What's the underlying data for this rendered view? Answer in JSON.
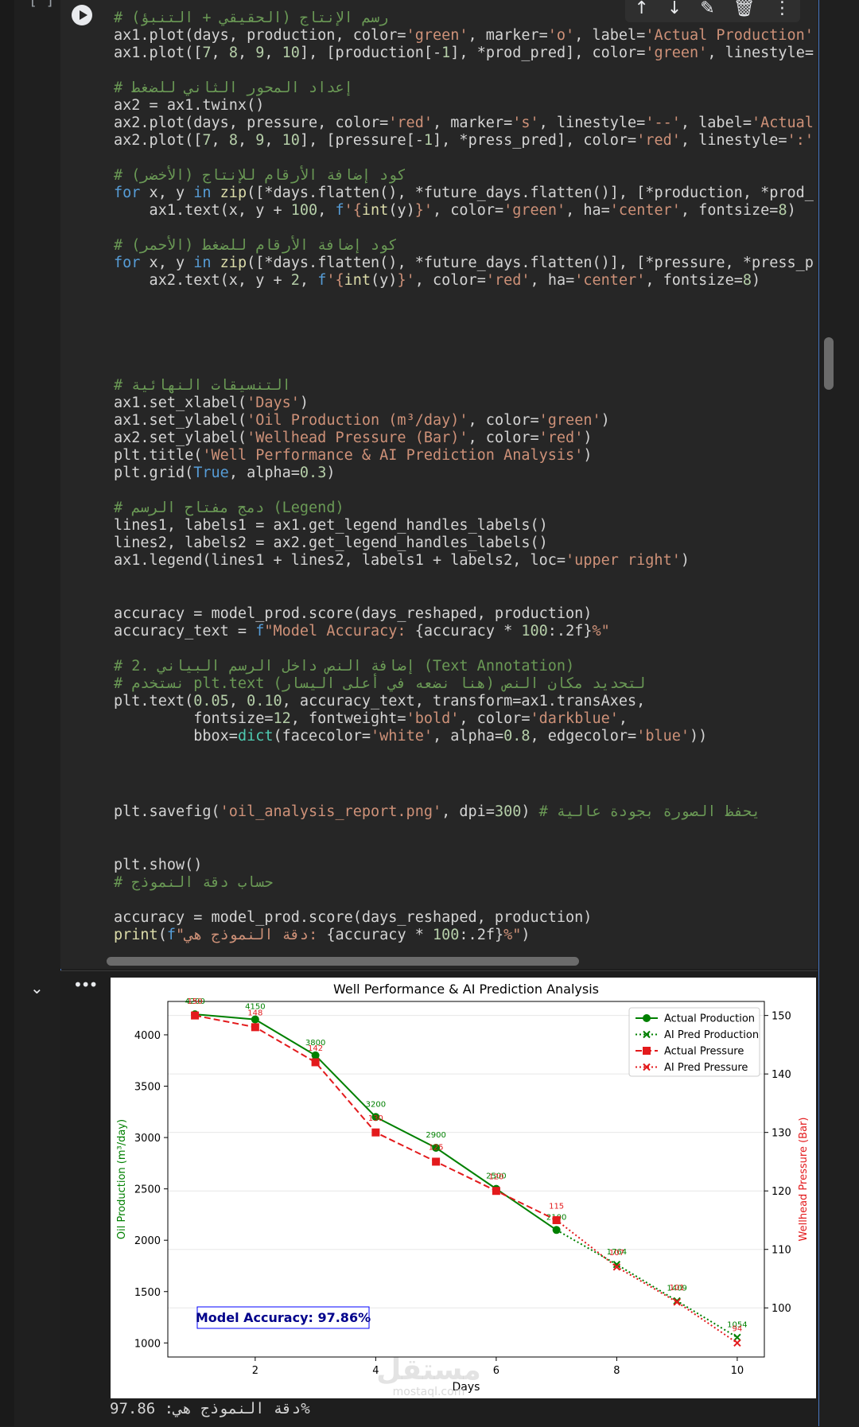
{
  "cell": {
    "bracket": "[ ]"
  },
  "toolbar": {
    "icons": [
      "arrow-up-icon",
      "arrow-down-icon",
      "edit-magic-icon",
      "trash-icon",
      "more-vert-icon"
    ],
    "glyphs": [
      "↑",
      "↓",
      "✎",
      "🗑",
      "⋮"
    ]
  },
  "code": {
    "lines": [
      {
        "y": 12,
        "parts": [
          [
            "c-com",
            "# رسم الإنتاج (الحقيقي + التنبؤ)"
          ]
        ]
      },
      {
        "y": 34,
        "parts": [
          [
            "",
            "ax1.plot(days, production, color="
          ],
          [
            "c-str",
            "'green'"
          ],
          [
            "",
            ", marker="
          ],
          [
            "c-str",
            "'o'"
          ],
          [
            "",
            ", label="
          ],
          [
            "c-str",
            "'Actual Production'"
          ],
          [
            "",
            ")"
          ]
        ]
      },
      {
        "y": 56,
        "parts": [
          [
            "",
            "ax1.plot(["
          ],
          [
            "c-num",
            "7"
          ],
          [
            "",
            ", "
          ],
          [
            "c-num",
            "8"
          ],
          [
            "",
            ", "
          ],
          [
            "c-num",
            "9"
          ],
          [
            "",
            ", "
          ],
          [
            "c-num",
            "10"
          ],
          [
            "",
            "], [production[-"
          ],
          [
            "c-num",
            "1"
          ],
          [
            "",
            "], *prod_pred], color="
          ],
          [
            "c-str",
            "'green'"
          ],
          [
            "",
            ", linestyle="
          ],
          [
            "c-str",
            "':'"
          ],
          [
            "",
            ","
          ]
        ]
      },
      {
        "y": 100,
        "parts": [
          [
            "c-com",
            "# إعداد المحور الثاني للضغط"
          ]
        ]
      },
      {
        "y": 122,
        "parts": [
          [
            "",
            "ax2 = ax1.twinx()"
          ]
        ]
      },
      {
        "y": 144,
        "parts": [
          [
            "",
            "ax2.plot(days, pressure, color="
          ],
          [
            "c-str",
            "'red'"
          ],
          [
            "",
            ", marker="
          ],
          [
            "c-str",
            "'s'"
          ],
          [
            "",
            ", linestyle="
          ],
          [
            "c-str",
            "'--'"
          ],
          [
            "",
            ", label="
          ],
          [
            "c-str",
            "'Actual Pre"
          ]
        ]
      },
      {
        "y": 166,
        "parts": [
          [
            "",
            "ax2.plot(["
          ],
          [
            "c-num",
            "7"
          ],
          [
            "",
            ", "
          ],
          [
            "c-num",
            "8"
          ],
          [
            "",
            ", "
          ],
          [
            "c-num",
            "9"
          ],
          [
            "",
            ", "
          ],
          [
            "c-num",
            "10"
          ],
          [
            "",
            "], [pressure[-"
          ],
          [
            "c-num",
            "1"
          ],
          [
            "",
            "], *press_pred], color="
          ],
          [
            "c-str",
            "'red'"
          ],
          [
            "",
            ", linestyle="
          ],
          [
            "c-str",
            "':'"
          ],
          [
            "",
            ", ma"
          ]
        ]
      },
      {
        "y": 210,
        "parts": [
          [
            "c-com",
            "# كود إضافة الأرقام للإنتاج (الأخضر)"
          ]
        ]
      },
      {
        "y": 232,
        "parts": [
          [
            "c-kw",
            "for"
          ],
          [
            "",
            " x, y "
          ],
          [
            "c-kw",
            "in"
          ],
          [
            "",
            " "
          ],
          [
            "c-fn",
            "zip"
          ],
          [
            "",
            "([*days.flatten(), *future_days.flatten()], [*production, *prod_pred"
          ]
        ]
      },
      {
        "y": 254,
        "parts": [
          [
            "",
            "    ax1.text(x, y + "
          ],
          [
            "c-num",
            "100"
          ],
          [
            "",
            ", "
          ],
          [
            "c-kw",
            "f"
          ],
          [
            "c-str",
            "'{"
          ],
          [
            "c-fn",
            "int"
          ],
          [
            "",
            "(y)"
          ],
          [
            "c-str",
            "}'"
          ],
          [
            "",
            ", color="
          ],
          [
            "c-str",
            "'green'"
          ],
          [
            "",
            ", ha="
          ],
          [
            "c-str",
            "'center'"
          ],
          [
            "",
            ", fontsize="
          ],
          [
            "c-num",
            "8"
          ],
          [
            "",
            ")"
          ]
        ]
      },
      {
        "y": 298,
        "parts": [
          [
            "c-com",
            "# كود إضافة الأرقام للضغط (الأحمر)"
          ]
        ]
      },
      {
        "y": 320,
        "parts": [
          [
            "c-kw",
            "for"
          ],
          [
            "",
            " x, y "
          ],
          [
            "c-kw",
            "in"
          ],
          [
            "",
            " "
          ],
          [
            "c-fn",
            "zip"
          ],
          [
            "",
            "([*days.flatten(), *future_days.flatten()], [*pressure, *press_pred]"
          ]
        ]
      },
      {
        "y": 342,
        "parts": [
          [
            "",
            "    ax2.text(x, y + "
          ],
          [
            "c-num",
            "2"
          ],
          [
            "",
            ", "
          ],
          [
            "c-kw",
            "f"
          ],
          [
            "c-str",
            "'{"
          ],
          [
            "c-fn",
            "int"
          ],
          [
            "",
            "(y)"
          ],
          [
            "c-str",
            "}'"
          ],
          [
            "",
            ", color="
          ],
          [
            "c-str",
            "'red'"
          ],
          [
            "",
            ", ha="
          ],
          [
            "c-str",
            "'center'"
          ],
          [
            "",
            ", fontsize="
          ],
          [
            "c-num",
            "8"
          ],
          [
            "",
            ")"
          ]
        ]
      },
      {
        "y": 474,
        "parts": [
          [
            "c-com",
            "# التنسيقات النهائية"
          ]
        ]
      },
      {
        "y": 496,
        "parts": [
          [
            "",
            "ax1.set_xlabel("
          ],
          [
            "c-str",
            "'Days'"
          ],
          [
            "",
            ")"
          ]
        ]
      },
      {
        "y": 518,
        "parts": [
          [
            "",
            "ax1.set_ylabel("
          ],
          [
            "c-str",
            "'Oil Production (m³/day)'"
          ],
          [
            "",
            ", color="
          ],
          [
            "c-str",
            "'green'"
          ],
          [
            "",
            ")"
          ]
        ]
      },
      {
        "y": 540,
        "parts": [
          [
            "",
            "ax2.set_ylabel("
          ],
          [
            "c-str",
            "'Wellhead Pressure (Bar)'"
          ],
          [
            "",
            ", color="
          ],
          [
            "c-str",
            "'red'"
          ],
          [
            "",
            ")"
          ]
        ]
      },
      {
        "y": 562,
        "parts": [
          [
            "",
            "plt.title("
          ],
          [
            "c-str",
            "'Well Performance & AI Prediction Analysis'"
          ],
          [
            "",
            ")"
          ]
        ]
      },
      {
        "y": 584,
        "parts": [
          [
            "",
            "plt.grid("
          ],
          [
            "c-kw",
            "True"
          ],
          [
            "",
            ", alpha="
          ],
          [
            "c-num",
            "0.3"
          ],
          [
            "",
            ")"
          ]
        ]
      },
      {
        "y": 628,
        "parts": [
          [
            "c-com",
            "# دمج مفتاح الرسم (Legend)"
          ]
        ]
      },
      {
        "y": 650,
        "parts": [
          [
            "",
            "lines1, labels1 = ax1.get_legend_handles_labels()"
          ]
        ]
      },
      {
        "y": 672,
        "parts": [
          [
            "",
            "lines2, labels2 = ax2.get_legend_handles_labels()"
          ]
        ]
      },
      {
        "y": 694,
        "parts": [
          [
            "",
            "ax1.legend(lines1 + lines2, labels1 + labels2, loc="
          ],
          [
            "c-str",
            "'upper right'"
          ],
          [
            "",
            ")"
          ]
        ]
      },
      {
        "y": 761,
        "parts": [
          [
            "",
            "accuracy = model_prod.score(days_reshaped, production)"
          ]
        ]
      },
      {
        "y": 783,
        "parts": [
          [
            "",
            "accuracy_text = "
          ],
          [
            "c-kw",
            "f"
          ],
          [
            "c-str",
            "\"Model Accuracy: "
          ],
          [
            "",
            "{accuracy * "
          ],
          [
            "c-num",
            "100"
          ],
          [
            "",
            ":.2f}"
          ],
          [
            "c-str",
            "%\""
          ]
        ]
      },
      {
        "y": 827,
        "parts": [
          [
            "c-com",
            "# 2. إضافة النص داخل الرسم البياني (Text Annotation)"
          ]
        ]
      },
      {
        "y": 849,
        "parts": [
          [
            "c-com",
            "# نستخدم plt.text لتحديد مكان النص (هنا نضعه في أعلى اليسار)"
          ]
        ]
      },
      {
        "y": 871,
        "parts": [
          [
            "",
            "plt.text("
          ],
          [
            "c-num",
            "0.05"
          ],
          [
            "",
            ", "
          ],
          [
            "c-num",
            "0.10"
          ],
          [
            "",
            ", accuracy_text, transform=ax1.transAxes,"
          ]
        ]
      },
      {
        "y": 893,
        "parts": [
          [
            "",
            "         fontsize="
          ],
          [
            "c-num",
            "12"
          ],
          [
            "",
            ", fontweight="
          ],
          [
            "c-str",
            "'bold'"
          ],
          [
            "",
            ", color="
          ],
          [
            "c-str",
            "'darkblue'"
          ],
          [
            "",
            ","
          ]
        ]
      },
      {
        "y": 915,
        "parts": [
          [
            "",
            "         bbox="
          ],
          [
            "c-bi",
            "dict"
          ],
          [
            "",
            "(facecolor="
          ],
          [
            "c-str",
            "'white'"
          ],
          [
            "",
            ", alpha="
          ],
          [
            "c-num",
            "0.8"
          ],
          [
            "",
            ", edgecolor="
          ],
          [
            "c-str",
            "'blue'"
          ],
          [
            "",
            "))"
          ]
        ]
      },
      {
        "y": 1010,
        "parts": [
          [
            "",
            "plt.savefig("
          ],
          [
            "c-str",
            "'oil_analysis_report.png'"
          ],
          [
            "",
            ", dpi="
          ],
          [
            "c-num",
            "300"
          ],
          [
            "",
            ") "
          ],
          [
            "c-com",
            "# يحفظ الصورة بجودة عالية"
          ]
        ]
      },
      {
        "y": 1077,
        "parts": [
          [
            "",
            "plt.show()"
          ]
        ]
      },
      {
        "y": 1099,
        "parts": [
          [
            "c-com",
            "# حساب دقة النموذج"
          ]
        ]
      },
      {
        "y": 1143,
        "parts": [
          [
            "",
            "accuracy = model_prod.score(days_reshaped, production)"
          ]
        ]
      },
      {
        "y": 1165,
        "parts": [
          [
            "c-fn",
            "print"
          ],
          [
            "",
            "("
          ],
          [
            "c-kw",
            "f"
          ],
          [
            "c-str",
            "\"دقة النموذج هي: "
          ],
          [
            "",
            "{accuracy * "
          ],
          [
            "c-num",
            "100"
          ],
          [
            "",
            ":.2f}"
          ],
          [
            "c-str",
            "%\""
          ],
          [
            "",
            ")"
          ]
        ]
      }
    ]
  },
  "output": {
    "text": "دقة النموذج هي: 97.86%"
  },
  "chart_data": {
    "type": "line",
    "title": "Well Performance & AI Prediction Analysis",
    "xlabel": "Days",
    "ylabel_left": "Oil Production (m³/day)",
    "ylabel_right": "Wellhead Pressure (Bar)",
    "xlim": [
      0.55,
      10.45
    ],
    "ylim_left": [
      863,
      4325
    ],
    "ylim_right": [
      91.6,
      152.4
    ],
    "xticks": [
      2,
      4,
      6,
      8,
      10
    ],
    "yticks_left": [
      1000,
      1500,
      2000,
      2500,
      3000,
      3500,
      4000
    ],
    "yticks_right": [
      100,
      110,
      120,
      130,
      140,
      150
    ],
    "grid": true,
    "legend_position": "upper right",
    "annotation": "Model Accuracy: 97.86%",
    "colors": {
      "production": "#008000",
      "pressure": "#e31a1c",
      "annotation": "#00008b"
    },
    "series": [
      {
        "name": "Actual Production",
        "axis": "left",
        "color": "#008000",
        "style": "solid",
        "marker": "o",
        "x": [
          1,
          2,
          3,
          4,
          5,
          6,
          7
        ],
        "y": [
          4200,
          4150,
          3800,
          3200,
          2900,
          2500,
          2100
        ],
        "labels": [
          "4200",
          "4150",
          "3800",
          "3200",
          "2900",
          "2500",
          "2100"
        ]
      },
      {
        "name": "AI Pred Production",
        "axis": "left",
        "color": "#008000",
        "style": "dotted",
        "marker": "x",
        "x": [
          7,
          8,
          9,
          10
        ],
        "y": [
          2100,
          1764,
          1409,
          1054
        ],
        "labels": [
          "",
          "1764",
          "1409",
          "1054"
        ]
      },
      {
        "name": "Actual Pressure",
        "axis": "right",
        "color": "#e31a1c",
        "style": "dashed",
        "marker": "s",
        "x": [
          1,
          2,
          3,
          4,
          5,
          6,
          7
        ],
        "y": [
          150,
          148,
          142,
          130,
          125,
          120,
          115
        ],
        "labels": [
          "150",
          "148",
          "142",
          "130",
          "125",
          "120",
          "115"
        ]
      },
      {
        "name": "AI Pred Pressure",
        "axis": "right",
        "color": "#e31a1c",
        "style": "dotted",
        "marker": "x",
        "x": [
          7,
          8,
          9,
          10
        ],
        "y": [
          115,
          107,
          101,
          94
        ],
        "labels": [
          "",
          "107",
          "101",
          "94"
        ]
      }
    ]
  },
  "watermark": {
    "logo_text": "مستقل",
    "url": "mostaql.com"
  }
}
